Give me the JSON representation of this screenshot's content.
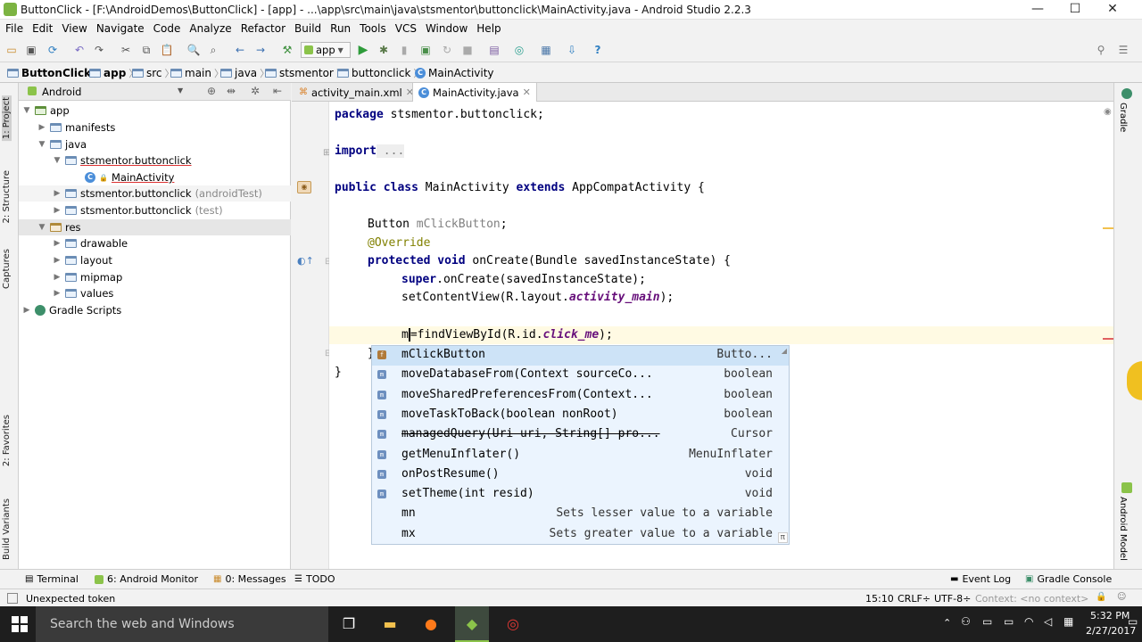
{
  "window": {
    "title": "ButtonClick - [F:\\AndroidDemos\\ButtonClick] - [app] - ...\\app\\src\\main\\java\\stsmentor\\buttonclick\\MainActivity.java - Android Studio 2.2.3",
    "minimize": "—",
    "maximize": "☐",
    "close": "✕"
  },
  "menu": [
    "File",
    "Edit",
    "View",
    "Navigate",
    "Code",
    "Analyze",
    "Refactor",
    "Build",
    "Run",
    "Tools",
    "VCS",
    "Window",
    "Help"
  ],
  "toolbar": {
    "run_config": "app"
  },
  "breadcrumbs": [
    "ButtonClick",
    "app",
    "src",
    "main",
    "java",
    "stsmentor",
    "buttonclick",
    "MainActivity"
  ],
  "project_panel": {
    "view_selector": "Android",
    "tree": [
      {
        "label": "app",
        "depth": 0,
        "expanded": true,
        "icon": "folder"
      },
      {
        "label": "manifests",
        "depth": 1,
        "expanded": false,
        "icon": "folder"
      },
      {
        "label": "java",
        "depth": 1,
        "expanded": true,
        "icon": "folder"
      },
      {
        "label": "stsmentor.buttonclick",
        "depth": 2,
        "expanded": true,
        "icon": "package",
        "suffix": ""
      },
      {
        "label": "MainActivity",
        "depth": 3,
        "icon": "class"
      },
      {
        "label": "stsmentor.buttonclick",
        "depth": 2,
        "expanded": false,
        "icon": "package",
        "suffix": "(androidTest)"
      },
      {
        "label": "stsmentor.buttonclick",
        "depth": 2,
        "expanded": false,
        "icon": "package",
        "suffix": "(test)"
      },
      {
        "label": "res",
        "depth": 1,
        "expanded": true,
        "icon": "folder",
        "selected": true
      },
      {
        "label": "drawable",
        "depth": 2,
        "expanded": false,
        "icon": "folder"
      },
      {
        "label": "layout",
        "depth": 2,
        "expanded": false,
        "icon": "folder"
      },
      {
        "label": "mipmap",
        "depth": 2,
        "expanded": false,
        "icon": "folder"
      },
      {
        "label": "values",
        "depth": 2,
        "expanded": false,
        "icon": "folder"
      },
      {
        "label": "Gradle Scripts",
        "depth": 0,
        "expanded": false,
        "icon": "gradle"
      }
    ]
  },
  "left_tool_labels": [
    "1: Project",
    "2: Structure",
    "Captures",
    "2: Favorites",
    "Build Variants"
  ],
  "right_tool_labels": [
    "Gradle",
    "Android Model"
  ],
  "editor_tabs": [
    {
      "label": "activity_main.xml",
      "active": false
    },
    {
      "label": "MainActivity.java",
      "active": true
    }
  ],
  "code": {
    "package_kw": "package",
    "package_name": " stsmentor.buttonclick;",
    "import_kw": "import",
    "import_rest": " ...",
    "class_line_kw1": "public class",
    "class_name": " MainActivity ",
    "class_line_kw2": "extends",
    "class_parent": " AppCompatActivity {",
    "field_type": "Button ",
    "field_name": "mClickButton",
    "field_end": ";",
    "override": "@Override",
    "method_kw": "protected void",
    "method_sig": " onCreate(Bundle savedInstanceState) {",
    "super_kw": "super",
    "super_rest": ".onCreate(savedInstanceState);",
    "setcontent_pre": "setContentView(R.layout.",
    "setcontent_res": "activity_main",
    "setcontent_post": ");",
    "typed_char": "m",
    "find_pre": "=findViewById(R.id.",
    "find_res": "click_me",
    "find_post": ");",
    "close_method": "}",
    "close_class": "}"
  },
  "completion": [
    {
      "name": "mClickButton",
      "type": "Butto...",
      "icon": "field",
      "highlight": true
    },
    {
      "name": "moveDatabaseFrom(Context sourceCo...",
      "type": "boolean",
      "icon": "method"
    },
    {
      "name": "moveSharedPreferencesFrom(Context...",
      "type": "boolean",
      "icon": "method"
    },
    {
      "name": "moveTaskToBack(boolean nonRoot)",
      "type": "boolean",
      "icon": "method"
    },
    {
      "name": "managedQuery(Uri uri, String[] pro...",
      "type": "Cursor",
      "icon": "method",
      "deprecated": true
    },
    {
      "name": "getMenuInflater()",
      "type": "MenuInflater",
      "icon": "method"
    },
    {
      "name": "onPostResume()",
      "type": "void",
      "icon": "method"
    },
    {
      "name": "setTheme(int resid)",
      "type": "void",
      "icon": "method"
    },
    {
      "name": "mn",
      "type": "Sets lesser value to a variable",
      "icon": "none"
    },
    {
      "name": "mx",
      "type": "Sets greater value to a variable",
      "icon": "none"
    }
  ],
  "completion_footer": "π",
  "bottom_tools_left": [
    {
      "label": "Terminal",
      "icon": "terminal-icon"
    },
    {
      "label": "6: Android Monitor",
      "icon": "android-icon"
    },
    {
      "label": "0: Messages",
      "icon": "messages-icon"
    },
    {
      "label": "TODO",
      "icon": "todo-icon"
    }
  ],
  "bottom_tools_right": [
    {
      "label": "Event Log",
      "icon": "log-icon"
    },
    {
      "label": "Gradle Console",
      "icon": "console-icon"
    }
  ],
  "status": {
    "message": "Unexpected token",
    "position": "15:10",
    "line_sep": "CRLF÷",
    "encoding": "UTF-8÷",
    "context": "Context: <no context>"
  },
  "taskbar": {
    "search_placeholder": "Search the web and Windows",
    "time": "5:32 PM",
    "date": "2/27/2017"
  }
}
